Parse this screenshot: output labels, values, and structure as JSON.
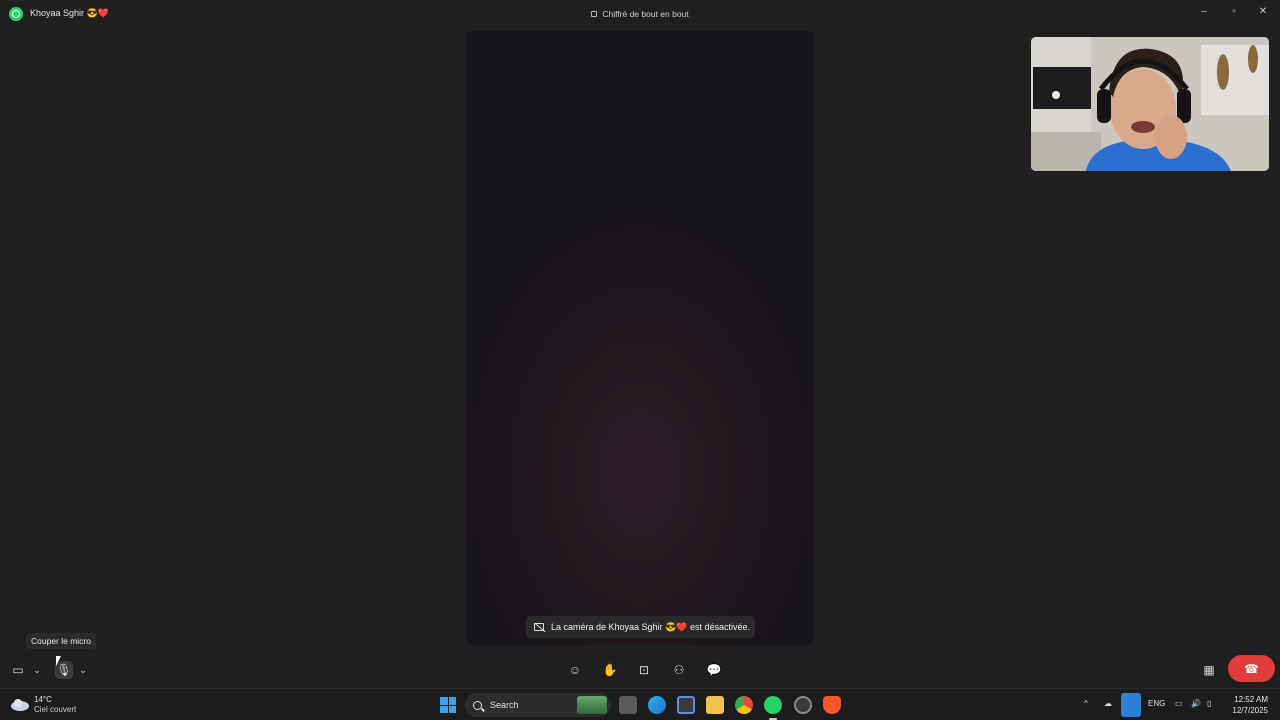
{
  "window": {
    "contact_name": "Khoyaa Sghir 😎❤️",
    "encryption_label": "Chiffré de bout en bout",
    "controls": [
      "minimize-icon",
      "maximize-icon",
      "close-icon"
    ]
  },
  "call": {
    "camera_off_notice": "La caméra de Khoyaa Sghir 😎❤️ est désactivée.",
    "tooltip": "Couper le micro"
  },
  "toolbar": {
    "left": [
      "video-camera-icon",
      "chevron-down-icon",
      "microphone-icon",
      "chevron-down-icon"
    ],
    "center": [
      "emoji-icon",
      "raise-hand-icon",
      "screen-share-icon",
      "add-person-icon",
      "chat-icon"
    ],
    "right": [
      "grid-layout-icon",
      "end-call-icon"
    ],
    "end_call_color": "#e23b3b"
  },
  "taskbar": {
    "weather_temp": "14°C",
    "weather_desc": "Ciel couvert",
    "search_placeholder": "Search",
    "language": "ENG",
    "time": "12:52 AM",
    "date": "12/7/2025",
    "accent": "#2f7fd8"
  }
}
